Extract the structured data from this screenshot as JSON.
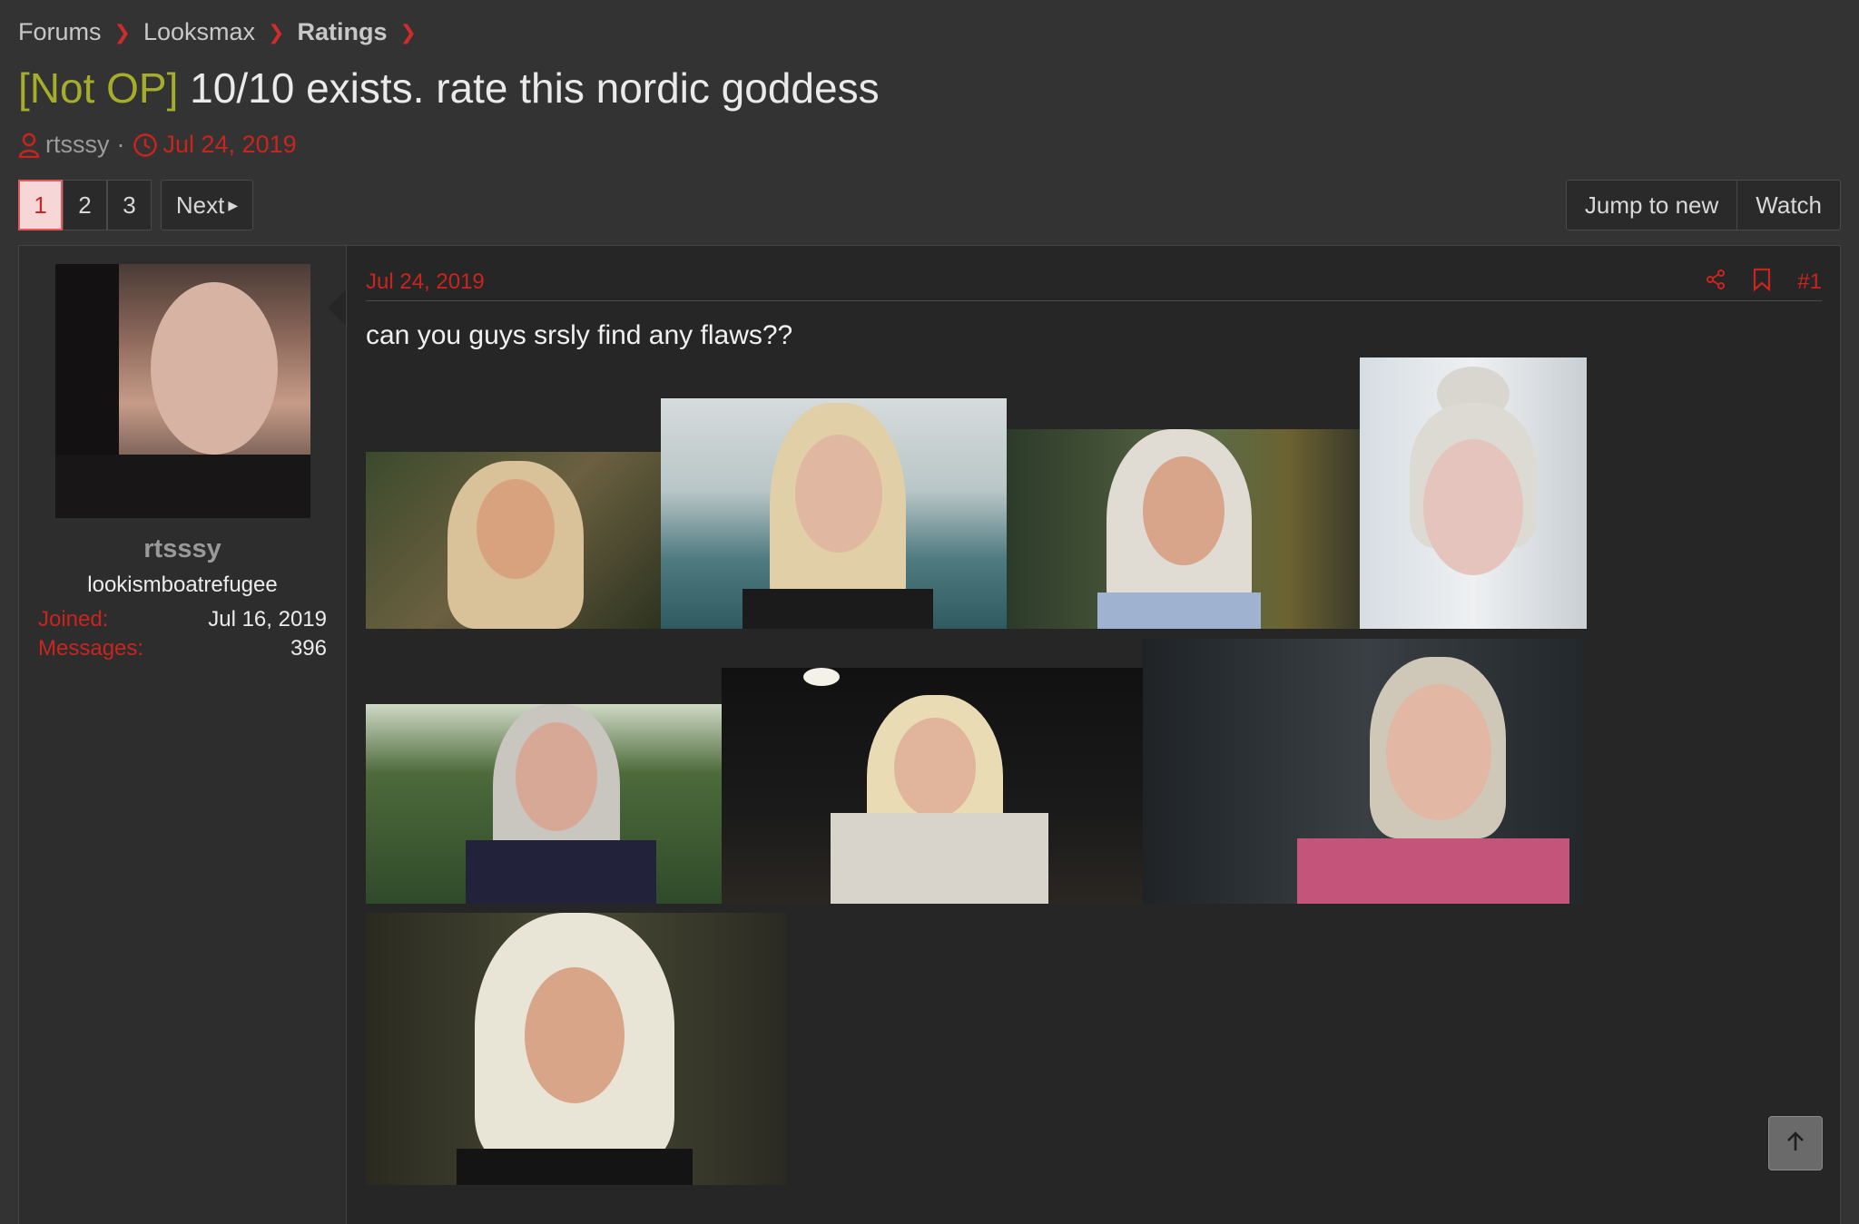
{
  "breadcrumb": {
    "items": [
      {
        "label": "Forums"
      },
      {
        "label": "Looksmax"
      },
      {
        "label": "Ratings"
      }
    ]
  },
  "thread": {
    "prefix": "[Not OP]",
    "title": "10/10 exists. rate this nordic goddess",
    "author": "rtsssy",
    "date": "Jul 24, 2019"
  },
  "pagination": {
    "pages": [
      "1",
      "2",
      "3"
    ],
    "current": "1",
    "next_label": "Next"
  },
  "actions": {
    "jump_label": "Jump to new",
    "watch_label": "Watch"
  },
  "post": {
    "user": {
      "name": "rtsssy",
      "title": "lookismboatrefugee",
      "joined_label": "Joined:",
      "joined_value": "Jul 16, 2019",
      "messages_label": "Messages:",
      "messages_value": "396"
    },
    "date": "Jul 24, 2019",
    "number": "#1",
    "body": "can you guys srsly find any flaws??",
    "image_count": 8
  },
  "icons": {
    "user": "user-icon",
    "clock": "clock-icon",
    "share": "share-icon",
    "bookmark": "bookmark-icon",
    "scroll_top": "arrow-up-icon"
  },
  "colors": {
    "accent": "#c9251f",
    "prefix": "#a6ad2b",
    "background": "#333333"
  }
}
